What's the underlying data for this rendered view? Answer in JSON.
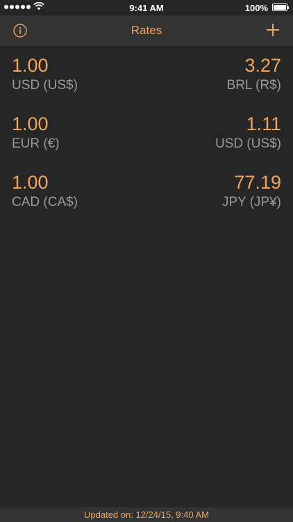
{
  "status_bar": {
    "time": "9:41 AM",
    "battery": "100%"
  },
  "nav": {
    "title": "Rates",
    "info_icon": "info-icon",
    "add_icon": "plus-icon"
  },
  "rates": [
    {
      "from_amount": "1.00",
      "from_currency": "USD (US$)",
      "to_amount": "3.27",
      "to_currency": "BRL (R$)"
    },
    {
      "from_amount": "1.00",
      "from_currency": "EUR (€)",
      "to_amount": "1.11",
      "to_currency": "USD (US$)"
    },
    {
      "from_amount": "1.00",
      "from_currency": "CAD (CA$)",
      "to_amount": "77.19",
      "to_currency": "JPY (JP¥)"
    }
  ],
  "footer": {
    "updated": "Updated on: 12/24/15, 9:40 AM"
  },
  "colors": {
    "accent": "#f0a55e",
    "background": "#262626",
    "bar": "#333333",
    "secondary_text": "#9a9a9a"
  }
}
